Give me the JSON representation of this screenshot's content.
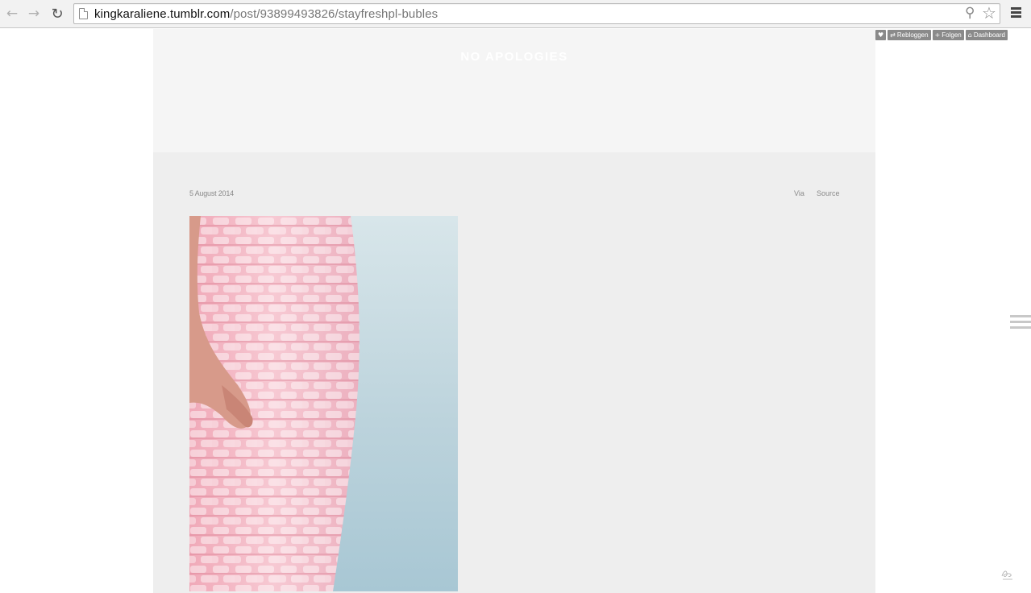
{
  "browser": {
    "url_host": "kingkaraliene.tumblr.com",
    "url_path": "/post/93899493826/stayfreshpl-bubles",
    "back_icon": "arrow-left-icon",
    "forward_icon": "arrow-right-icon",
    "reload_icon": "reload-icon",
    "search_icon": "magnifier-icon",
    "bookmark_icon": "star-icon",
    "menu_icon": "hamburger-icon"
  },
  "blog": {
    "title": "NO APOLOGIES"
  },
  "post": {
    "date": "5 August 2014",
    "via_label": "Via",
    "source_label": "Source"
  },
  "tumblr_controls": {
    "like_icon": "heart-icon",
    "reblog_label": "Rebloggen",
    "follow_label": "Folgen",
    "dashboard_label": "Dashboard"
  },
  "colors": {
    "header_band": "#f5f5f5",
    "post_background": "#eeeeee",
    "control_buttons": "#8a8a8a"
  }
}
